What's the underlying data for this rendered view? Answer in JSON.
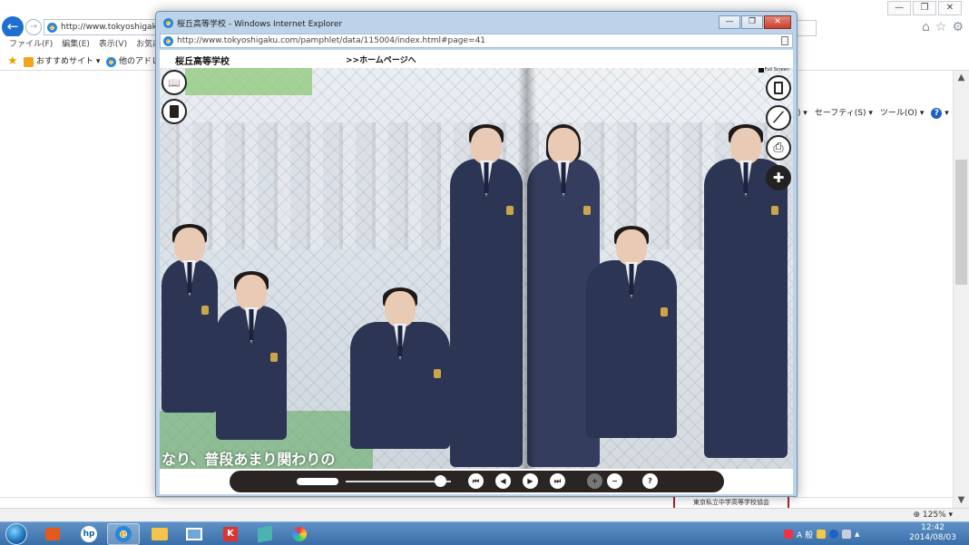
{
  "background_browser": {
    "address_text": "http://www.tokyoshigaku",
    "menu": [
      "ファイル(F)",
      "編集(E)",
      "表示(V)",
      "お気に"
    ],
    "favorites": {
      "recommended": "おすすめサイト ▾",
      "other": "他のアドレ"
    },
    "command_bar": [
      "(P) ▾",
      "セーフティ(S) ▾",
      "ツール(O) ▾"
    ],
    "window_controls": [
      "—",
      "❐",
      "✕"
    ],
    "right_icons": [
      "⌂",
      "☆",
      "⚙"
    ],
    "status_zoom": "125% ▾",
    "banner_text": "東京私立中学高等学校協会",
    "icons": {
      "back": "back-arrow-icon",
      "forward": "forward-arrow-icon",
      "home": "home-icon",
      "favorites": "star-icon",
      "settings": "gear-icon"
    }
  },
  "popup": {
    "title": "桜丘高等学校 - Windows Internet Explorer",
    "controls": [
      "—",
      "❐",
      "✕"
    ],
    "address": "http://www.tokyoshigaku.com/pamphlet/data/115004/index.html#page=41"
  },
  "viewer": {
    "school_name": "桜丘高等学校",
    "home_link": ">>ホームページへ",
    "fullscreen_label": "Full Screen",
    "caption": "なり、普段あまり関わりの",
    "left_buttons": [
      {
        "name": "open-book-icon",
        "glyph": "📖"
      },
      {
        "name": "single-page-icon",
        "glyph": "▯"
      }
    ],
    "right_buttons": [
      {
        "name": "page-icon",
        "glyph": "▯"
      },
      {
        "name": "pen-icon",
        "glyph": "⟋"
      },
      {
        "name": "print-icon",
        "glyph": "⎙"
      },
      {
        "name": "zoom-in-icon",
        "glyph": "✚"
      }
    ],
    "controls": {
      "first_page": "⏮",
      "prev_page": "◀",
      "next_page": "▶",
      "last_page": "⏭",
      "zoom_in": "+",
      "zoom_out": "−",
      "help": "?"
    },
    "page_slider_fraction": 0.9
  },
  "taskbar": {
    "clock_time": "12:42",
    "clock_date": "2014/08/03",
    "ime_label": "A 般"
  }
}
